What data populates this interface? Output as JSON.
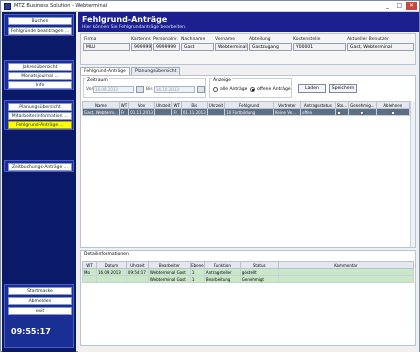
{
  "window": {
    "title": "MTZ Business Solution - Webterminal",
    "buttons": [
      "_",
      "□",
      "✕"
    ]
  },
  "sidebar": {
    "top_buttons": [
      "Buchen",
      "Fehlgründe beantragen ..."
    ],
    "mid_buttons": [
      "Jahresübersicht",
      "Monatsjournal ...",
      "Info"
    ],
    "lower_buttons": [
      "Planungsübersicht",
      "Mitarbeiterinformation ...",
      "Fehlgrund-Anträge ..."
    ],
    "extra_buttons": [
      "Zeitbuchungs-Anträge ..."
    ],
    "bottom_buttons": [
      "Startmaske",
      "Abmelden",
      "exit"
    ],
    "clock": "09:55:17"
  },
  "header": {
    "title": "Fehlgrund-Anträge",
    "subtitle": "Hier können Sie Fehlgrundanträge bearbeiten."
  },
  "employee": {
    "labels": [
      "Firma",
      "Kartennr.",
      "Personalnr.",
      "Nachname",
      "Vorname",
      "Abteilung",
      "Kostenstelle",
      "Aktueller Benutzer"
    ],
    "values": [
      "MLU",
      "9999999",
      "9999999",
      "Gast",
      "Webterminal",
      "Gastzugang",
      "Y00001",
      "Gast, Webterminal"
    ]
  },
  "tabs": [
    "Fehlgrund-Anträge",
    "Planungsübersicht"
  ],
  "filter": {
    "zeitraum_label": "Zeitraum",
    "von_label": "Von",
    "von_value": "16.09.2013",
    "bis_label": "Bis",
    "bis_value": "16.10.2013",
    "anzeige_label": "Anzeige",
    "radio_all": "alle Anträge",
    "radio_open": "offene Anträge",
    "load_button": "Laden",
    "save_button": "Speichern"
  },
  "table": {
    "headers": [
      "Name",
      "WT",
      "Von",
      "Uhrzeit",
      "WT",
      "Bis",
      "Uhrzeit",
      "Fehlgrund",
      "Vertreter",
      "Antragsstatus",
      "Sto...",
      "Genehmig...",
      "Ablehnen"
    ],
    "rows": [
      [
        "Gast, Webterm...",
        "Fr",
        "01.11.2013",
        "",
        "Fr",
        "01.11.2013",
        "",
        "10 Fortbildung",
        "Keine Ve...",
        "offen"
      ]
    ]
  },
  "detail": {
    "label": "Detailinformationen",
    "headers": [
      "WT",
      "Datum",
      "Uhrzeit",
      "Bearbeiter",
      "Ebene",
      "Funktion",
      "Status",
      "Kommentar"
    ],
    "rows": [
      [
        "Mo",
        "16.09.2013",
        "09:54:17",
        "Webterminal Gast",
        "1",
        "Antragsteller",
        "gestellt",
        ""
      ],
      [
        "",
        "",
        "",
        "Webterminal Gast",
        "1",
        "Bearbeitung",
        "Genehmigt",
        ""
      ]
    ]
  },
  "colors": {
    "header": "#1b1f8f",
    "sidebar": "#0a1a68",
    "active_button": "#ffff00",
    "selected_row": "#5d6f85",
    "detail_row": "#c8e8c8"
  }
}
